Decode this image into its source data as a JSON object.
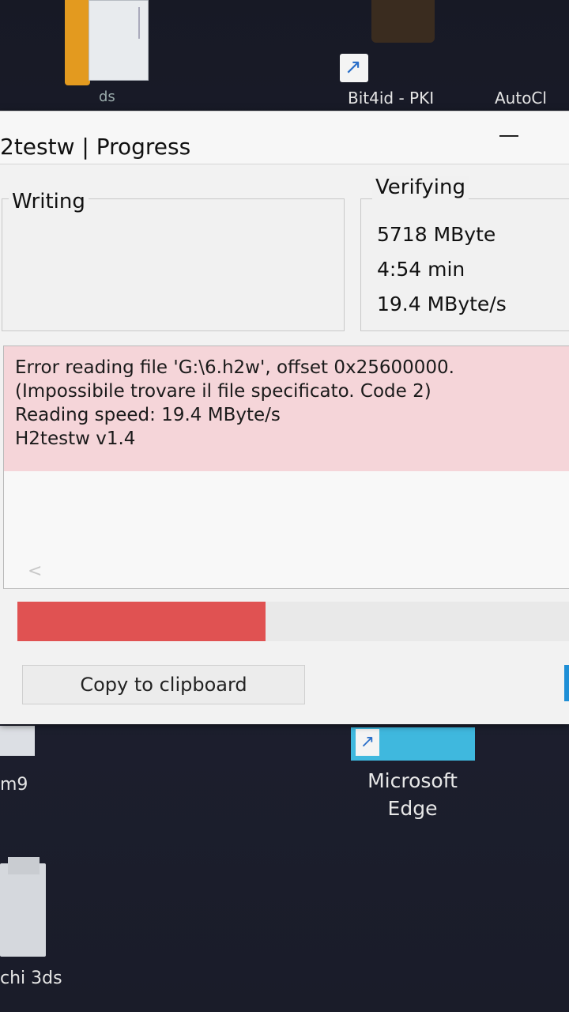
{
  "desktop": {
    "top_labels": {
      "ds": "ds",
      "bit4id": "Bit4id - PKI",
      "auto": "AutoCl"
    },
    "edge_label": "Microsoft Edge",
    "m9_label": "m9",
    "chi_label": "chi 3ds",
    "icons": [
      "folder-icon",
      "file-icon",
      "shortcut-icon",
      "edge-icon"
    ]
  },
  "window": {
    "title": "2testw | Progress",
    "writing": {
      "label": "Writing"
    },
    "verifying": {
      "label": "Verifying",
      "size": "5718 MByte",
      "time": "4:54 min",
      "speed": "19.4 MByte/s"
    },
    "log_lines": [
      "Error reading file 'G:\\6.h2w', offset 0x25600000.",
      "(Impossibile trovare il file specificato. Code 2)",
      "Reading speed: 19.4 MByte/s",
      "H2testw v1.4"
    ],
    "progress": {
      "fraction": 0.45,
      "color": "#e05252"
    },
    "copy_button_label": "Copy to clipboard",
    "log_error_bg": "#f5d5d9"
  }
}
